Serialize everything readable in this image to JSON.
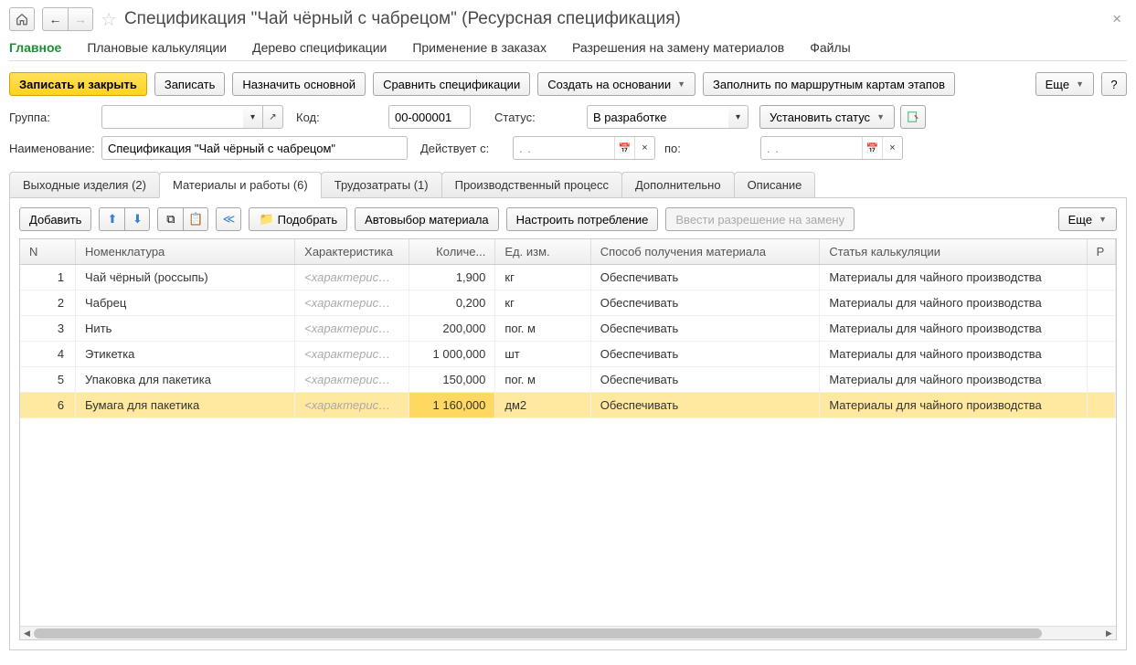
{
  "header": {
    "title": "Спецификация \"Чай чёрный с чабрецом\" (Ресурсная спецификация)"
  },
  "nav": {
    "main": "Главное",
    "plan_calc": "Плановые калькуляции",
    "spec_tree": "Дерево спецификации",
    "orders_usage": "Применение в заказах",
    "mat_permissions": "Разрешения на замену материалов",
    "files": "Файлы"
  },
  "cmd": {
    "save_close": "Записать и закрыть",
    "save": "Записать",
    "set_main": "Назначить основной",
    "compare": "Сравнить спецификации",
    "create_based": "Создать на основании",
    "fill_route": "Заполнить по маршрутным картам этапов",
    "more": "Еще",
    "help": "?"
  },
  "form": {
    "group_label": "Группа:",
    "group_value": "",
    "code_label": "Код:",
    "code_value": "00-000001",
    "status_label": "Статус:",
    "status_value": "В разработке",
    "set_status": "Установить статус",
    "name_label": "Наименование:",
    "name_value": "Спецификация \"Чай чёрный с чабрецом\"",
    "valid_from_label": "Действует с:",
    "date_placeholder": ".   .",
    "to_label": "по:"
  },
  "tabs": {
    "output": "Выходные изделия (2)",
    "materials": "Материалы и работы (6)",
    "labor": "Трудозатраты (1)",
    "process": "Производственный процесс",
    "extra": "Дополнительно",
    "desc": "Описание"
  },
  "tbl_cmd": {
    "add": "Добавить",
    "select": "Подобрать",
    "auto_material": "Автовыбор материала",
    "configure": "Настроить потребление",
    "permission": "Ввести разрешение на замену",
    "more": "Еще"
  },
  "columns": {
    "n": "N",
    "nomen": "Номенклатура",
    "char": "Характеристика",
    "qty": "Количе...",
    "unit": "Ед. изм.",
    "supply": "Способ получения материала",
    "article": "Статья калькуляции",
    "p": "Р"
  },
  "placeholder_char": "<характеристи...",
  "rows": [
    {
      "n": "1",
      "nomen": "Чай чёрный (россыпь)",
      "qty": "1,900",
      "unit": "кг",
      "supply": "Обеспечивать",
      "article": "Материалы для чайного производства",
      "sel": false
    },
    {
      "n": "2",
      "nomen": "Чабрец",
      "qty": "0,200",
      "unit": "кг",
      "supply": "Обеспечивать",
      "article": "Материалы для чайного производства",
      "sel": false
    },
    {
      "n": "3",
      "nomen": "Нить",
      "qty": "200,000",
      "unit": "пог. м",
      "supply": "Обеспечивать",
      "article": "Материалы для чайного производства",
      "sel": false
    },
    {
      "n": "4",
      "nomen": "Этикетка",
      "qty": "1 000,000",
      "unit": "шт",
      "supply": "Обеспечивать",
      "article": "Материалы для чайного производства",
      "sel": false
    },
    {
      "n": "5",
      "nomen": "Упаковка для пакетика",
      "qty": "150,000",
      "unit": "пог. м",
      "supply": "Обеспечивать",
      "article": "Материалы для чайного производства",
      "sel": false
    },
    {
      "n": "6",
      "nomen": "Бумага для пакетика",
      "qty": "1 160,000",
      "unit": "дм2",
      "supply": "Обеспечивать",
      "article": "Материалы для чайного производства",
      "sel": true
    }
  ]
}
